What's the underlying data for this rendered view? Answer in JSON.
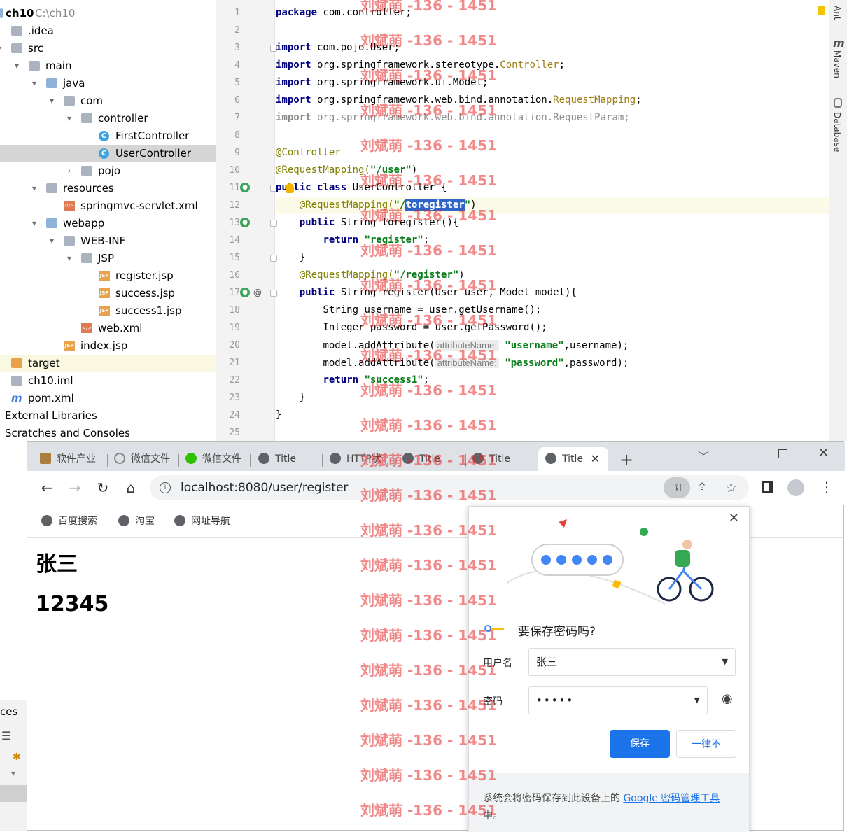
{
  "project_tree": {
    "root_name": "ch10",
    "root_path": "C:\\ch10",
    "items": [
      {
        "label": "ch10",
        "depth": 0,
        "icon": "folder-icon"
      },
      {
        "label": ".idea",
        "depth": 1,
        "icon": "folder-icon"
      },
      {
        "label": "src",
        "depth": 1,
        "icon": "folder-icon"
      },
      {
        "label": "main",
        "depth": 2,
        "icon": "folder-icon"
      },
      {
        "label": "java",
        "depth": 3,
        "icon": "folder-icon"
      },
      {
        "label": "com",
        "depth": 4,
        "icon": "package-icon"
      },
      {
        "label": "controller",
        "depth": 5,
        "icon": "package-icon"
      },
      {
        "label": "FirstController",
        "depth": 6,
        "icon": "class-icon"
      },
      {
        "label": "UserController",
        "depth": 6,
        "icon": "class-icon"
      },
      {
        "label": "pojo",
        "depth": 5,
        "icon": "package-icon"
      },
      {
        "label": "resources",
        "depth": 3,
        "icon": "folder-icon"
      },
      {
        "label": "springmvc-servlet.xml",
        "depth": 4,
        "icon": "xml-icon"
      },
      {
        "label": "webapp",
        "depth": 3,
        "icon": "folder-icon"
      },
      {
        "label": "WEB-INF",
        "depth": 4,
        "icon": "folder-icon"
      },
      {
        "label": "JSP",
        "depth": 5,
        "icon": "folder-icon"
      },
      {
        "label": "register.jsp",
        "depth": 6,
        "icon": "jsp-icon"
      },
      {
        "label": "success.jsp",
        "depth": 6,
        "icon": "jsp-icon"
      },
      {
        "label": "success1.jsp",
        "depth": 6,
        "icon": "jsp-icon"
      },
      {
        "label": "web.xml",
        "depth": 5,
        "icon": "xml-icon"
      },
      {
        "label": "index.jsp",
        "depth": 4,
        "icon": "jsp-icon"
      },
      {
        "label": "target",
        "depth": 1,
        "icon": "folder-icon"
      },
      {
        "label": "ch10.iml",
        "depth": 1,
        "icon": "file-icon"
      },
      {
        "label": "pom.xml",
        "depth": 1,
        "icon": "maven-icon"
      },
      {
        "label": "External Libraries",
        "depth": 0,
        "icon": "library-icon"
      },
      {
        "label": "Scratches and Consoles",
        "depth": 0,
        "icon": "scratch-icon"
      }
    ],
    "bottom_fragment": "ces"
  },
  "editor": {
    "line_numbers": [
      "1",
      "2",
      "3",
      "4",
      "5",
      "6",
      "7",
      "8",
      "9",
      "10",
      "11",
      "12",
      "13",
      "14",
      "15",
      "16",
      "17",
      "18",
      "19",
      "20",
      "21",
      "22",
      "23",
      "24",
      "25"
    ],
    "lines": {
      "l1_kw": "package",
      "l1_rest": " com.controller;",
      "l3_kw": "import",
      "l3_rest": " com.pojo.User;",
      "l4_kw": "import",
      "l4_a": " org.springframework.stereotype.",
      "l4_b": "Controller",
      "l4_c": ";",
      "l5_kw": "import",
      "l5_rest": " org.springframework.ui.Model;",
      "l6_kw": "import",
      "l6_a": " org.springframework.web.bind.annotation.",
      "l6_b": "RequestMapping",
      "l6_c": ";",
      "l7_kw": "import",
      "l7_rest": " org.springframework.web.bind.annotation.RequestParam;",
      "l9": "@Controller",
      "l10_ann": "@RequestMapping(",
      "l10_str": "\"/user\"",
      "l10_end": ")",
      "l11_kw": "public class",
      "l11_rest": " UserController {",
      "l12_ann": "@RequestMapping(",
      "l12_str_a": "\"/",
      "l12_sel": "toregister",
      "l12_str_b": "\"",
      "l12_end": ")",
      "l13_kw": "public",
      "l13_rest": " String toregister(){",
      "l14_kw": "return",
      "l14_str": "\"register\"",
      "l14_end": ";",
      "l15": "}",
      "l16_ann": "@RequestMapping(",
      "l16_str": "\"/register\"",
      "l16_end": ")",
      "l17_kw": "public",
      "l17_rest": " String register(User user, Model model){",
      "l18": "String username = user.getUsername();",
      "l19": "Integer password = user.getPassword();",
      "l20_a": "model.addAttribute(",
      "l20_hint": "attributeName:",
      "l20_str": "\"username\"",
      "l20_end": ",username);",
      "l21_a": "model.addAttribute(",
      "l21_hint": "attributeName:",
      "l21_str": "\"password\"",
      "l21_end": ",password);",
      "l22_kw": "return",
      "l22_str": "\"success1\"",
      "l22_end": ";",
      "l23": "}",
      "l24": "}"
    },
    "gutter_at": "@"
  },
  "right_sidebar": {
    "ant": "Ant",
    "maven": "Maven",
    "database": "Database"
  },
  "browser": {
    "tabs": [
      {
        "label": "软件产业"
      },
      {
        "label": "微信文件"
      },
      {
        "label": "微信文件"
      },
      {
        "label": "Title"
      },
      {
        "label": "HTTP状"
      },
      {
        "label": "Title"
      },
      {
        "label": "Title"
      },
      {
        "label": "Title"
      }
    ],
    "new_tab": "+",
    "url": "localhost:8080/user/register",
    "bookmarks": [
      "百度搜索",
      "淘宝",
      "网址导航"
    ],
    "page": {
      "name": "张三",
      "password": "12345"
    }
  },
  "password_popup": {
    "title": "要保存密码吗?",
    "username_label": "用户名",
    "username_value": "张三",
    "password_label": "密码",
    "password_value": "•••••",
    "save_button": "保存",
    "never_button": "一律不",
    "footer_prefix": "系统会将密码保存到此设备上的 ",
    "footer_link": "Google 密码管理工具",
    "footer_suffix": "中。"
  },
  "watermark": "刘斌萌 -136 - 1451",
  "colors": {
    "accent": "#1a73e8",
    "selection": "#2f65ca",
    "string": "#067d17",
    "keyword": "#000080",
    "annotation": "#808000"
  }
}
